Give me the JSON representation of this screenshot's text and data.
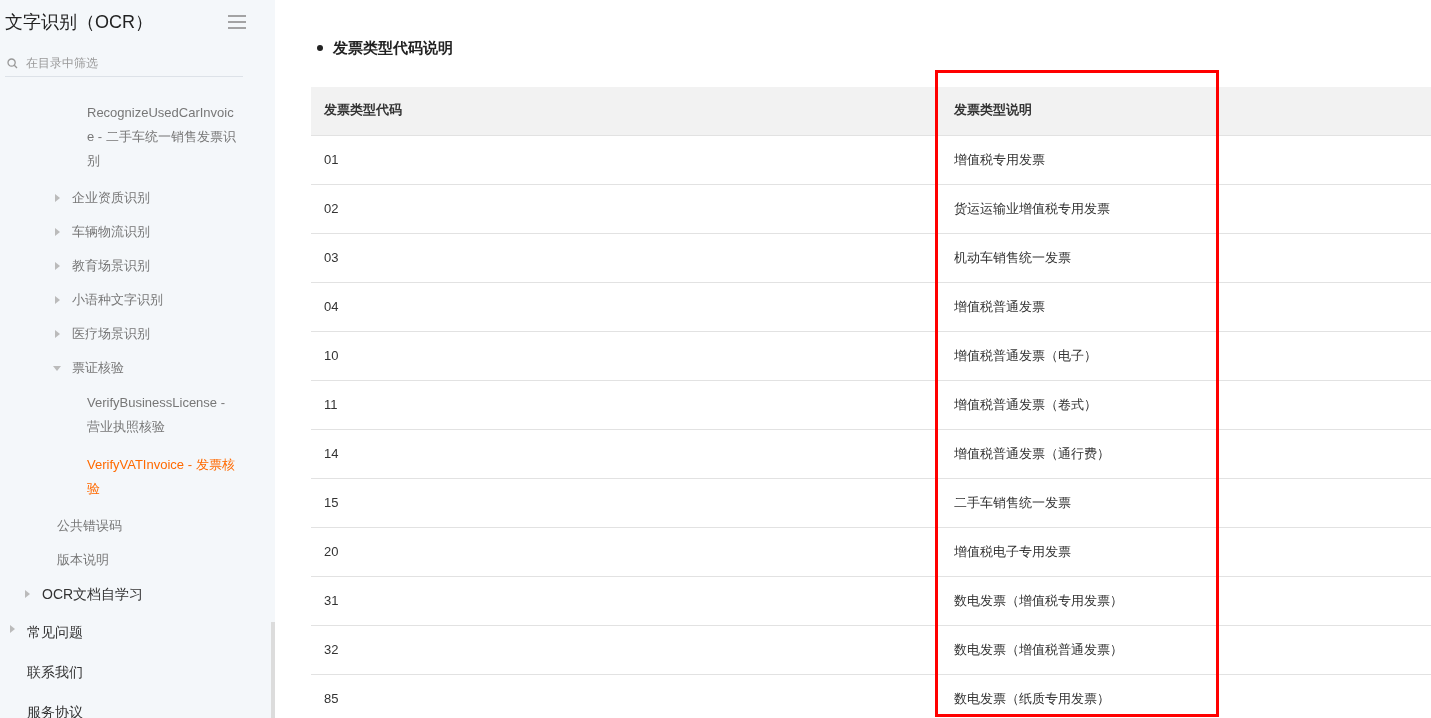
{
  "sidebar": {
    "title": "文字识别（OCR）",
    "filter": {
      "placeholder": "在目录中筛选"
    },
    "nav": [
      {
        "children": [
          {
            "children": [
              {
                "children": [
                  {
                    "children": [
                      {
                        "label": "RecognizeUsedCarInvoice - 二手车统一销售发票识别",
                        "selected": false
                      }
                    ]
                  },
                  {
                    "label": "企业资质识别",
                    "expanded": false
                  },
                  {
                    "label": "车辆物流识别",
                    "expanded": false
                  },
                  {
                    "label": "教育场景识别",
                    "expanded": false
                  },
                  {
                    "label": "小语种文字识别",
                    "expanded": false
                  },
                  {
                    "label": "医疗场景识别",
                    "expanded": false
                  },
                  {
                    "label": "票证核验",
                    "expanded": true,
                    "children": [
                      {
                        "label": "VerifyBusinessLicense - 营业执照核验",
                        "selected": false
                      },
                      {
                        "label": "VerifyVATInvoice - 发票核验",
                        "selected": true
                      }
                    ]
                  }
                ]
              },
              {
                "label": "公共错误码",
                "selected": false
              },
              {
                "label": "版本说明",
                "selected": false
              }
            ]
          },
          {
            "label": "OCR文档自学习",
            "expanded": false
          }
        ]
      },
      {
        "label": "常见问题",
        "expanded": false
      },
      {
        "label": "联系我们",
        "selected": false
      },
      {
        "label": "服务协议",
        "selected": false
      }
    ]
  },
  "content": {
    "heading": "发票类型代码说明",
    "table": {
      "columns": [
        {
          "label": "发票类型代码",
          "highlighted": false
        },
        {
          "label": "发票类型说明",
          "highlighted": true
        }
      ],
      "rows": [
        [
          "01",
          "增值税专用发票"
        ],
        [
          "02",
          "货运运输业增值税专用发票"
        ],
        [
          "03",
          "机动车销售统一发票"
        ],
        [
          "04",
          "增值税普通发票"
        ],
        [
          "10",
          "增值税普通发票（电子）"
        ],
        [
          "11",
          "增值税普通发票（卷式）"
        ],
        [
          "14",
          "增值税普通发票（通行费）"
        ],
        [
          "15",
          "二手车销售统一发票"
        ],
        [
          "20",
          "增值税电子专用发票"
        ],
        [
          "31",
          "数电发票（增值税专用发票）"
        ],
        [
          "32",
          "数电发票（增值税普通发票）"
        ],
        [
          "85",
          "数电发票（纸质专用发票）"
        ]
      ]
    }
  }
}
